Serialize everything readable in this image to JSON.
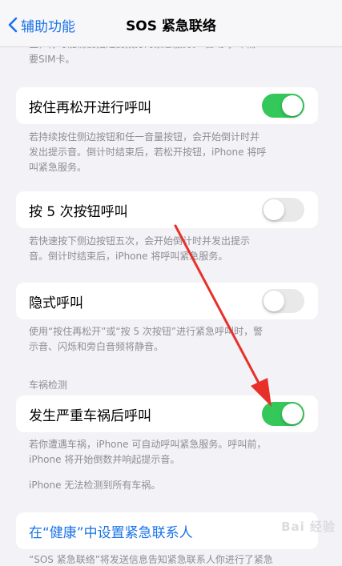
{
  "nav": {
    "back_label": "辅助功能",
    "title": "SOS 紧急联络"
  },
  "intro": {
    "line1": "区，你可能需要指定要拨打的紧急服务。 自动呼叫 需",
    "line2": "要SIM卡。"
  },
  "settings": {
    "hold_release": {
      "label": "按住再松开进行呼叫",
      "on": true,
      "footer": [
        "若持续按住侧边按钮和任一音量按钮，会开始倒计时并",
        "发出提示音。倒计时结束后，若松开按钮，iPhone 将呼",
        "叫紧急服务。"
      ]
    },
    "press_five": {
      "label": "按 5 次按钮呼叫",
      "on": false,
      "footer": [
        "若快速按下侧边按钮五次，会开始倒计时并发出提示",
        "音。倒计时结束后，iPhone 将呼叫紧急服务。"
      ]
    },
    "silent": {
      "label": "隐式呼叫",
      "on": false,
      "footer": [
        "使用“按住再松开”或“按 5 次按钮”进行紧急呼叫时，警",
        "示音、闪烁和旁白音频将静音。"
      ]
    },
    "crash_section_header": "车祸检测",
    "crash": {
      "label": "发生严重车祸后呼叫",
      "on": true,
      "footer": [
        "若你遭遇车祸，iPhone 可自动呼叫紧急服务。呼叫前，",
        "iPhone 将开始倒数并响起提示音。"
      ],
      "note": "iPhone 无法检测到所有车祸。"
    }
  },
  "health_link": "在“健康”中设置紧急联系人",
  "bottom_partial": "“SOS 紧急联络”将发送信息告知紧急联系人你进行了紧急",
  "watermark": "Bai 经验",
  "colors": {
    "accent": "#1a73e8",
    "toggle_on": "#34c759",
    "toggle_off": "#e9e9ea",
    "annotation_arrow": "#e8302a"
  }
}
